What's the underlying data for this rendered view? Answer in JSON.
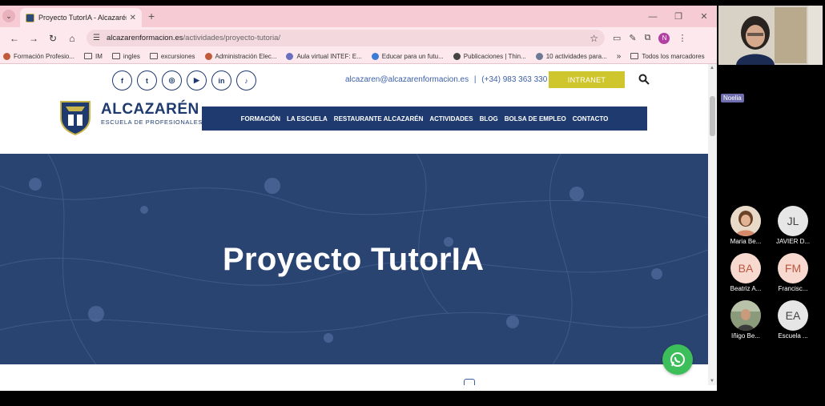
{
  "browser": {
    "tab_title": "Proyecto TutorIA - Alcazarén Fo",
    "url_host": "alcazarenformacion.es",
    "url_path": "/actividades/proyecto-tutoria/",
    "profile_initial": "N",
    "bookmarks": [
      "Formación Profesio...",
      "IM",
      "ingles",
      "excursiones",
      "Administración Elec...",
      "Aula virtual INTEF: E...",
      "Educar para un futu...",
      "Publicaciones | Thin...",
      "10 actividades para..."
    ],
    "bookmarks_more": "»",
    "all_bookmarks": "Todos los marcadores"
  },
  "site": {
    "email": "alcazaren@alcazarenformacion.es",
    "separator": "|",
    "phone": "(+34) 983 363 330",
    "intranet": "INTRANET",
    "logo_name": "ALCAZARÉN",
    "logo_sub": "ESCUELA DE PROFESIONALES",
    "nav": [
      "FORMACIÓN",
      "LA ESCUELA",
      "RESTAURANTE ALCAZARÉN",
      "ACTIVIDADES",
      "BLOG",
      "BOLSA DE EMPLEO",
      "CONTACTO"
    ],
    "hero_title": "Proyecto TutorIA"
  },
  "call": {
    "presenter_name": "Noelia",
    "participants": [
      {
        "initials": "",
        "name": "Maria Be...",
        "photo": true,
        "bg": "#d9a48b"
      },
      {
        "initials": "JL",
        "name": "JAVIER D...",
        "photo": false,
        "bg": "#e6e6e6"
      },
      {
        "initials": "BA",
        "name": "Beatriz A...",
        "photo": false,
        "bg": "#f7d9cf"
      },
      {
        "initials": "FM",
        "name": "Francisc...",
        "photo": false,
        "bg": "#f7d9cf"
      },
      {
        "initials": "",
        "name": "Iñigo Be...",
        "photo": true,
        "bg": "#7a8c6e"
      },
      {
        "initials": "EA",
        "name": "Escuela ...",
        "photo": false,
        "bg": "#e6e6e6"
      }
    ]
  },
  "colors": {
    "brand_navy": "#1e3a6e",
    "brand_yellow": "#cfc62e",
    "tab_pink": "#f6cbd3",
    "whatsapp_green": "#3cbf5a"
  }
}
